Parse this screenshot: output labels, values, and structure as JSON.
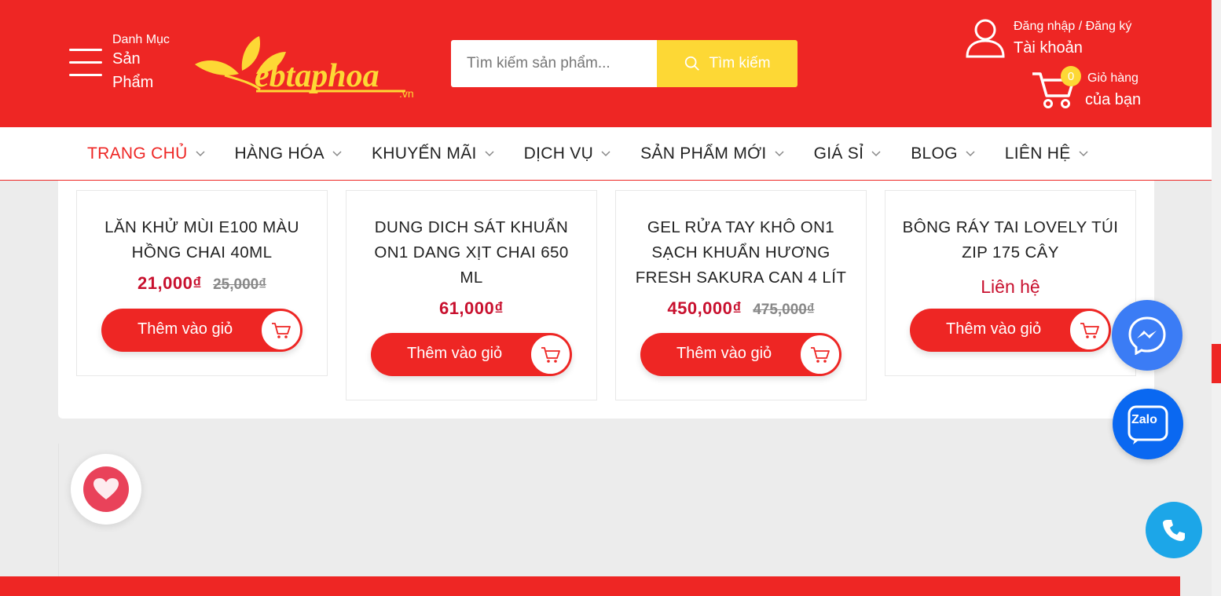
{
  "header": {
    "category_small": "Danh Mục",
    "category_big": "Sản Phẩm",
    "logo_text": "ebtaphoa",
    "logo_suffix": ".vn",
    "search_placeholder": "Tìm kiếm sản phẩm...",
    "search_button": "Tìm kiếm",
    "account_small": "Đăng nhập / Đăng ký",
    "account_big": "Tài khoản",
    "cart_count": "0",
    "cart_small": "Giỏ hàng",
    "cart_big": "của bạn"
  },
  "nav": [
    {
      "label": "TRANG CHỦ",
      "active": true
    },
    {
      "label": "HÀNG HÓA",
      "active": false
    },
    {
      "label": "KHUYẾN MÃI",
      "active": false
    },
    {
      "label": "DỊCH VỤ",
      "active": false
    },
    {
      "label": "SẢN PHẨM MỚI",
      "active": false
    },
    {
      "label": "GIÁ SỈ",
      "active": false
    },
    {
      "label": "BLOG",
      "active": false
    },
    {
      "label": "LIÊN HỆ",
      "active": false
    }
  ],
  "products": [
    {
      "name": "LĂN KHỬ MÙI E100 MÀU HỒNG CHAI 40ML",
      "price": "21,000₫",
      "old_price": "25,000₫",
      "button": "Thêm vào giỏ"
    },
    {
      "name": "DUNG DICH SÁT KHUẨN ON1 DANG XỊT CHAI 650 ML",
      "price": "61,000₫",
      "old_price": "",
      "button": "Thêm vào giỏ"
    },
    {
      "name": "GEL RỬA TAY KHÔ ON1 SẠCH KHUẨN HƯƠNG FRESH SAKURA CAN 4 LÍT",
      "price": "450,000₫",
      "old_price": "475,000₫",
      "button": "Thêm vào giỏ"
    },
    {
      "name": "BÔNG RÁY TAI LOVELY TÚI ZIP 175 CÂY",
      "price": "Liên hệ",
      "old_price": "",
      "button": "Thêm vào giỏ"
    }
  ],
  "floating": {
    "zalo_label": "Zalo"
  },
  "colors": {
    "brand_red": "#ee2624",
    "search_yellow": "#fdd835",
    "price_red": "#c8102e",
    "messenger_blue": "#3b7cf5",
    "zalo_blue": "#0a68f1",
    "phone_blue": "#1ca6e8"
  },
  "icons": [
    "menu-icon",
    "search-icon",
    "user-icon",
    "cart-icon",
    "chevron-down-icon",
    "heart-icon",
    "messenger-icon",
    "zalo-icon",
    "phone-icon"
  ]
}
